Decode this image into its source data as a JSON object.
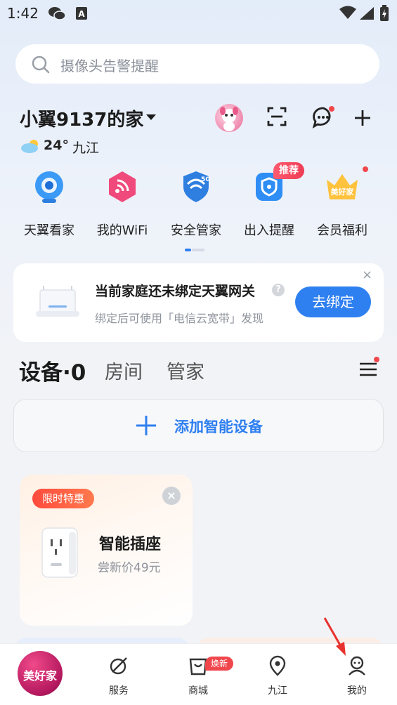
{
  "status_bar": {
    "time": "1:42",
    "icons": [
      "wechat-icon",
      "font-a-icon",
      "wifi-icon",
      "signal-icon",
      "battery-charging-icon"
    ]
  },
  "search": {
    "placeholder": "摄像头告警提醒",
    "icon": "search-icon"
  },
  "header": {
    "home_name": "小翼9137的家",
    "weather_temp": "24°",
    "weather_city": "九江",
    "icons": [
      "avatar",
      "scan-icon",
      "message-icon",
      "add-icon"
    ]
  },
  "quick_entries": [
    {
      "label": "天翼看家",
      "icon": "camera-icon"
    },
    {
      "label": "我的WiFi",
      "icon": "wifi-tile-icon"
    },
    {
      "label": "安全管家",
      "icon": "shield-5g-icon"
    },
    {
      "label": "出入提醒",
      "icon": "location-shield-icon",
      "badge": "推荐"
    },
    {
      "label": "会员福利",
      "icon": "crown-icon",
      "logo_text": "美好家"
    }
  ],
  "bind_card": {
    "title": "当前家庭还未绑定天翼网关",
    "subtitle": "绑定后可使用「电信云宽带」发现",
    "button": "去绑定",
    "help": "?",
    "close": "×"
  },
  "tabs": {
    "devices": "设备·0",
    "rooms": "房间",
    "butler": "管家"
  },
  "add_device": {
    "label": "添加智能设备",
    "plus": "+"
  },
  "promo": {
    "badge": "限时特惠",
    "title": "智能插座",
    "price": "尝新价49元",
    "close": "×"
  },
  "bottom_nav": {
    "logo_text": "美好家",
    "items": [
      {
        "label": "服务",
        "icon": "service-icon"
      },
      {
        "label": "商城",
        "icon": "shop-bag-icon",
        "badge": "焕新"
      },
      {
        "label": "九江",
        "icon": "location-pin-icon"
      },
      {
        "label": "我的",
        "icon": "profile-icon"
      }
    ]
  },
  "colors": {
    "accent": "#2e7ff0",
    "badge_red": "#f0474d",
    "promo_orange": "#ff5a3d"
  }
}
